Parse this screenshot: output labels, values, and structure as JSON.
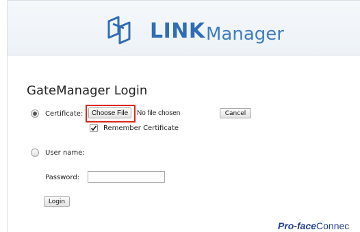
{
  "header": {
    "logo_word": "LINK",
    "logo_suffix": "Manager",
    "brand_color": "#2f6db5"
  },
  "login": {
    "title": "GateManager Login",
    "certificate_label": "Certificate:",
    "choose_file_label": "Choose File",
    "no_file_text": "No file chosen",
    "cancel_label": "Cancel",
    "remember_label": "Remember Certificate",
    "remember_checked": true,
    "username_label": "User name:",
    "password_label": "Password:",
    "password_value": "",
    "login_label": "Login",
    "selected_method": "certificate"
  },
  "footer": {
    "brand_bold": "Pro-face",
    "brand_rest": "Connec"
  },
  "annotation": {
    "highlight_color": "#d9261c"
  }
}
